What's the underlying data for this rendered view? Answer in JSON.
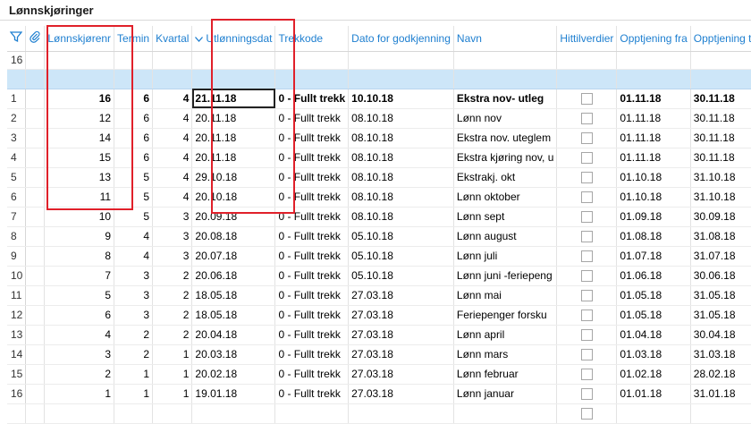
{
  "panel": {
    "title": "Lønnskjøringer"
  },
  "filter_row_label": "16",
  "columns": [
    {
      "key": "rownum",
      "label": ""
    },
    {
      "key": "attach",
      "label": ""
    },
    {
      "key": "lonnskjorenr",
      "label": "Lønnskjørenr"
    },
    {
      "key": "termin",
      "label": "Termin"
    },
    {
      "key": "kvartal",
      "label": "Kvartal"
    },
    {
      "key": "utlonningsdato",
      "label": "Utlønningsdat"
    },
    {
      "key": "trekkode",
      "label": "Trekkode"
    },
    {
      "key": "dato_godkjenning",
      "label": "Dato for godkjenning"
    },
    {
      "key": "navn",
      "label": "Navn"
    },
    {
      "key": "hittilverdier",
      "label": "Hittilverdier"
    },
    {
      "key": "opptjening_fra",
      "label": "Opptjening fra"
    },
    {
      "key": "opptjening_til",
      "label": "Opptjening til"
    }
  ],
  "icons": {
    "filter": "filter-icon",
    "attach": "paperclip-icon",
    "sort": "sort-descending-icon"
  },
  "rows": [
    {
      "rownum": "1",
      "nr": "16",
      "termin": "6",
      "kvartal": "4",
      "utl": "21.11.18",
      "trekk": "0 - Fullt trekk",
      "godkj": "10.10.18",
      "navn": "Ekstra nov- utleg",
      "fra": "01.11.18",
      "til": "30.11.18",
      "bold": true
    },
    {
      "rownum": "2",
      "nr": "12",
      "termin": "6",
      "kvartal": "4",
      "utl": "20.11.18",
      "trekk": "0 - Fullt trekk",
      "godkj": "08.10.18",
      "navn": "Lønn nov",
      "fra": "01.11.18",
      "til": "30.11.18"
    },
    {
      "rownum": "3",
      "nr": "14",
      "termin": "6",
      "kvartal": "4",
      "utl": "20.11.18",
      "trekk": "0 - Fullt trekk",
      "godkj": "08.10.18",
      "navn": "Ekstra nov. uteglem",
      "fra": "01.11.18",
      "til": "30.11.18"
    },
    {
      "rownum": "4",
      "nr": "15",
      "termin": "6",
      "kvartal": "4",
      "utl": "20.11.18",
      "trekk": "0 - Fullt trekk",
      "godkj": "08.10.18",
      "navn": "Ekstra kjøring nov, u",
      "fra": "01.11.18",
      "til": "30.11.18"
    },
    {
      "rownum": "5",
      "nr": "13",
      "termin": "5",
      "kvartal": "4",
      "utl": "29.10.18",
      "trekk": "0 - Fullt trekk",
      "godkj": "08.10.18",
      "navn": "Ekstrakj. okt",
      "fra": "01.10.18",
      "til": "31.10.18"
    },
    {
      "rownum": "6",
      "nr": "11",
      "termin": "5",
      "kvartal": "4",
      "utl": "20.10.18",
      "trekk": "0 - Fullt trekk",
      "godkj": "08.10.18",
      "navn": "Lønn oktober",
      "fra": "01.10.18",
      "til": "31.10.18"
    },
    {
      "rownum": "7",
      "nr": "10",
      "termin": "5",
      "kvartal": "3",
      "utl": "20.09.18",
      "trekk": "0 - Fullt trekk",
      "godkj": "08.10.18",
      "navn": "Lønn sept",
      "fra": "01.09.18",
      "til": "30.09.18"
    },
    {
      "rownum": "8",
      "nr": "9",
      "termin": "4",
      "kvartal": "3",
      "utl": "20.08.18",
      "trekk": "0 - Fullt trekk",
      "godkj": "05.10.18",
      "navn": "Lønn august",
      "fra": "01.08.18",
      "til": "31.08.18"
    },
    {
      "rownum": "9",
      "nr": "8",
      "termin": "4",
      "kvartal": "3",
      "utl": "20.07.18",
      "trekk": "0 - Fullt trekk",
      "godkj": "05.10.18",
      "navn": "Lønn juli",
      "fra": "01.07.18",
      "til": "31.07.18"
    },
    {
      "rownum": "10",
      "nr": "7",
      "termin": "3",
      "kvartal": "2",
      "utl": "20.06.18",
      "trekk": "0 - Fullt trekk",
      "godkj": "05.10.18",
      "navn": "Lønn juni -feriepeng",
      "fra": "01.06.18",
      "til": "30.06.18"
    },
    {
      "rownum": "11",
      "nr": "5",
      "termin": "3",
      "kvartal": "2",
      "utl": "18.05.18",
      "trekk": "0 - Fullt trekk",
      "godkj": "27.03.18",
      "navn": "Lønn mai",
      "fra": "01.05.18",
      "til": "31.05.18"
    },
    {
      "rownum": "12",
      "nr": "6",
      "termin": "3",
      "kvartal": "2",
      "utl": "18.05.18",
      "trekk": "0 - Fullt trekk",
      "godkj": "27.03.18",
      "navn": "Feriepenger forsku",
      "fra": "01.05.18",
      "til": "31.05.18"
    },
    {
      "rownum": "13",
      "nr": "4",
      "termin": "2",
      "kvartal": "2",
      "utl": "20.04.18",
      "trekk": "0 - Fullt trekk",
      "godkj": "27.03.18",
      "navn": "Lønn april",
      "fra": "01.04.18",
      "til": "30.04.18"
    },
    {
      "rownum": "14",
      "nr": "3",
      "termin": "2",
      "kvartal": "1",
      "utl": "20.03.18",
      "trekk": "0 - Fullt trekk",
      "godkj": "27.03.18",
      "navn": "Lønn mars",
      "fra": "01.03.18",
      "til": "31.03.18"
    },
    {
      "rownum": "15",
      "nr": "2",
      "termin": "1",
      "kvartal": "1",
      "utl": "20.02.18",
      "trekk": "0 - Fullt trekk",
      "godkj": "27.03.18",
      "navn": "Lønn februar",
      "fra": "01.02.18",
      "til": "28.02.18"
    },
    {
      "rownum": "16",
      "nr": "1",
      "termin": "1",
      "kvartal": "1",
      "utl": "19.01.18",
      "trekk": "0 - Fullt trekk",
      "godkj": "27.03.18",
      "navn": "Lønn januar",
      "fra": "01.01.18",
      "til": "31.01.18"
    }
  ],
  "colors": {
    "header_text": "#1e7fd0",
    "new_row_bg": "#cde6f8",
    "annotation_box": "#e0202a"
  }
}
